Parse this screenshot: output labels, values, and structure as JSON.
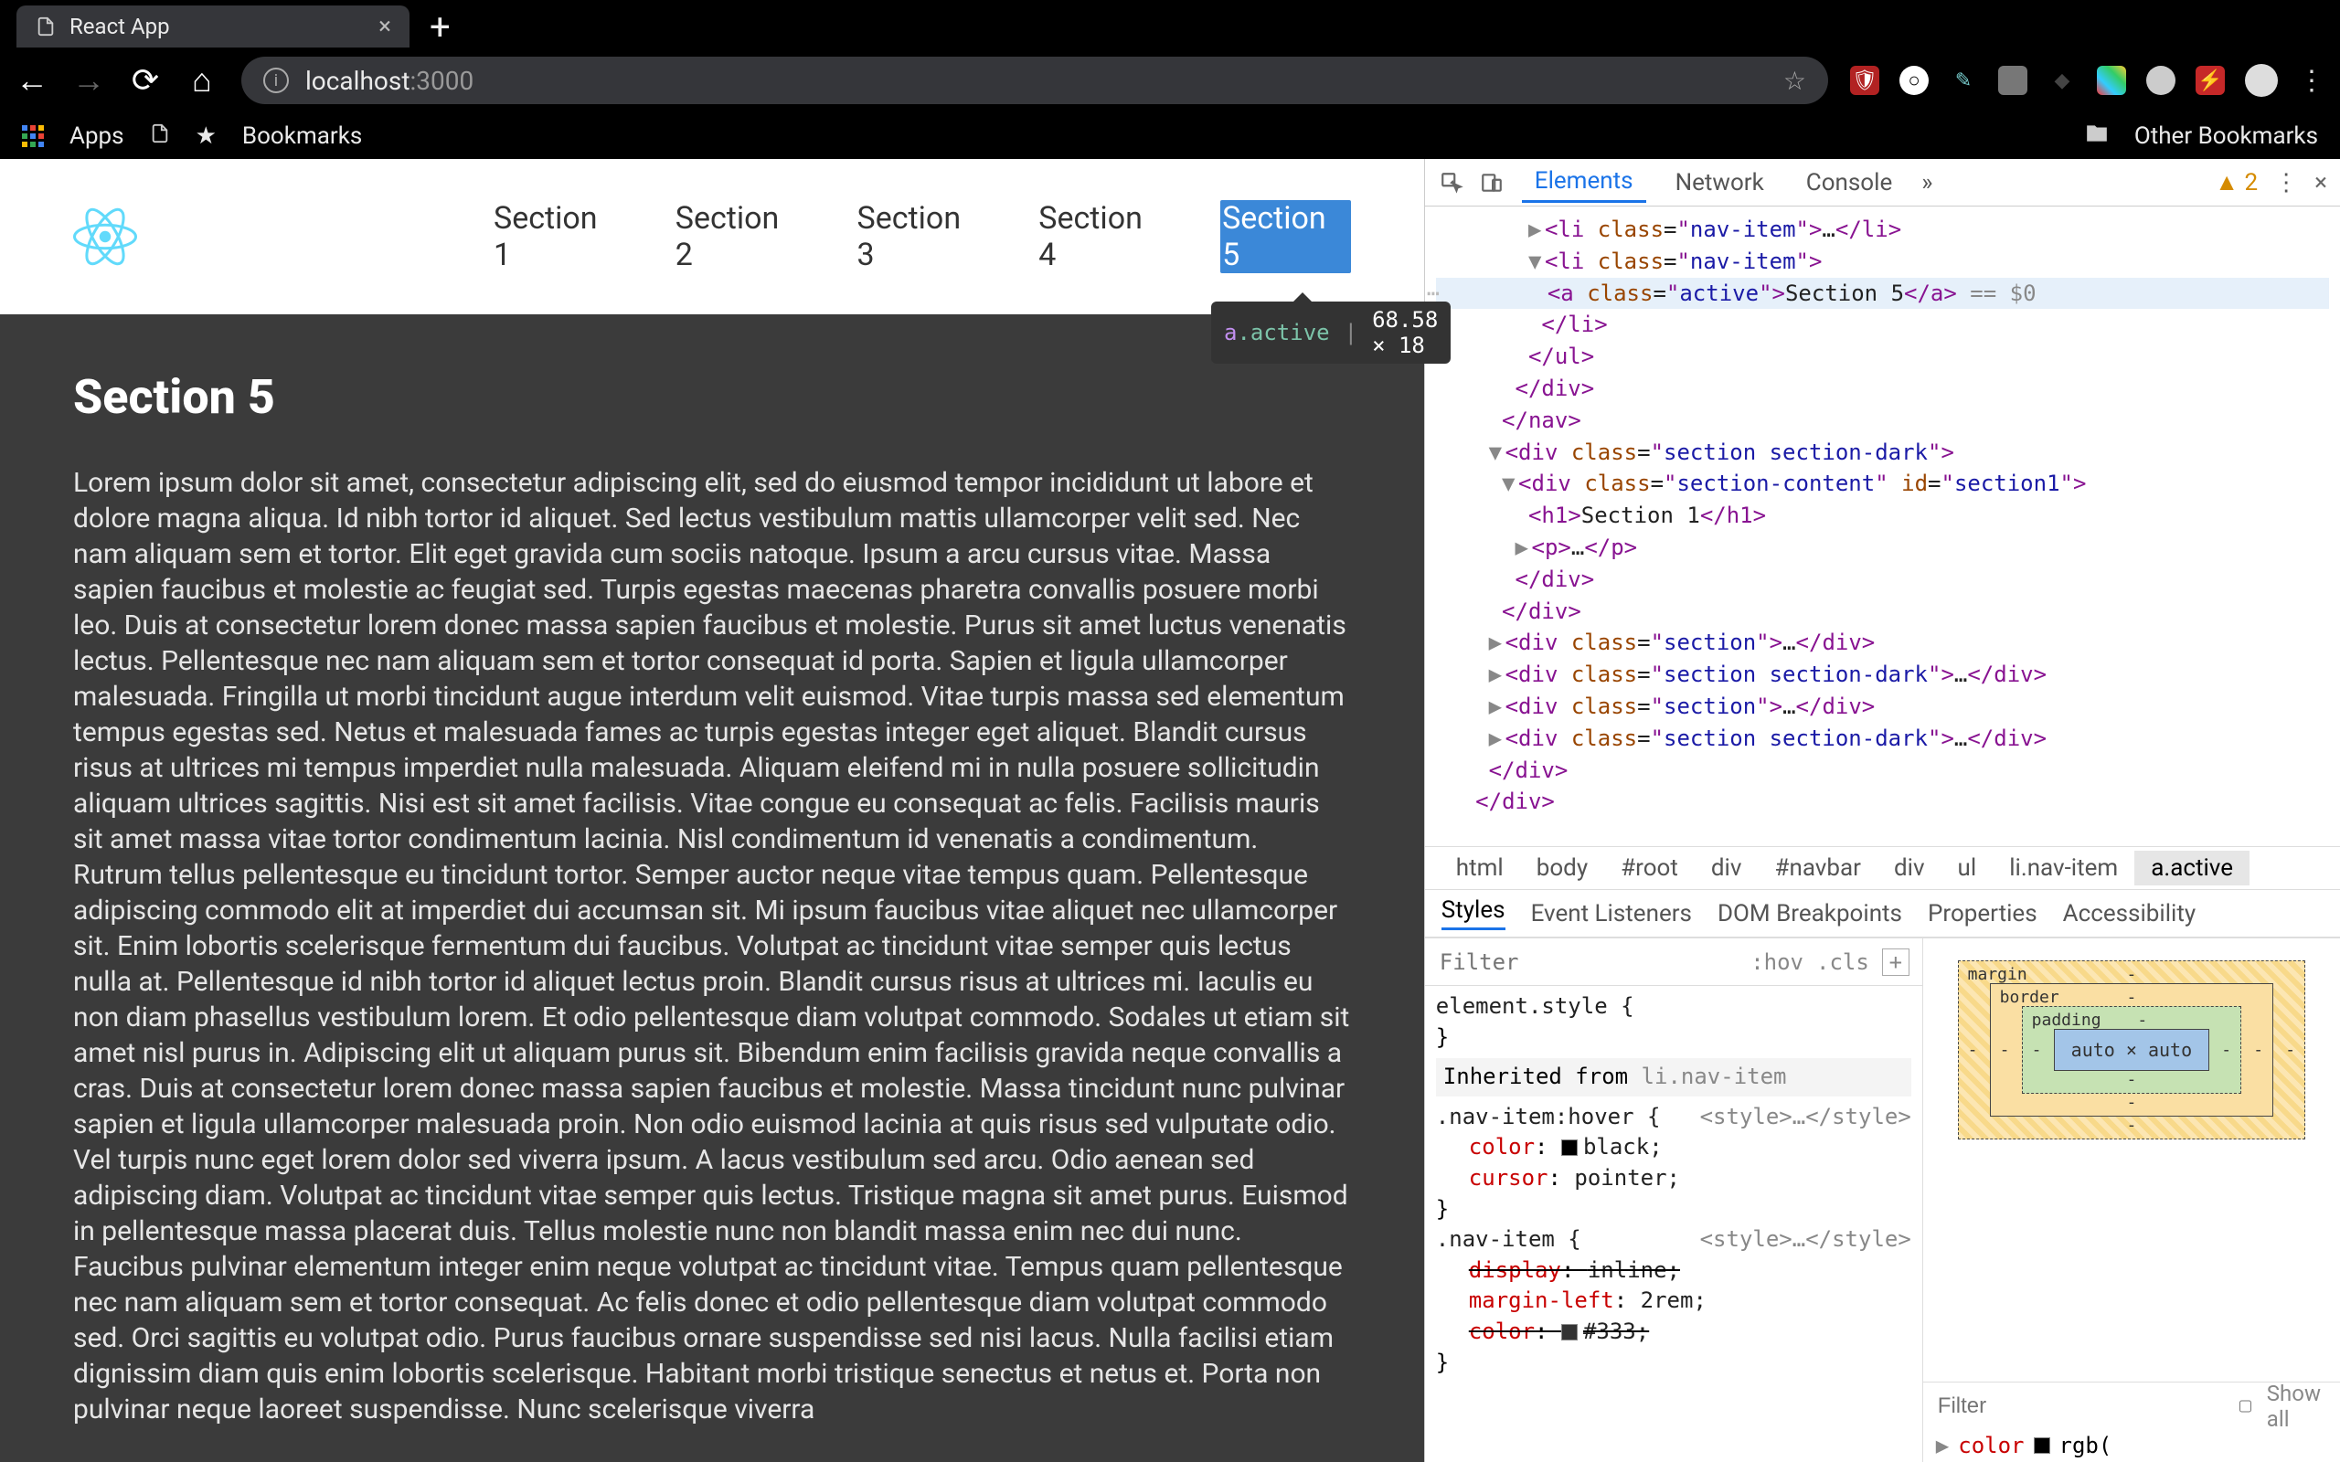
{
  "browser": {
    "tab_title": "React App",
    "new_tab_label": "+",
    "url_host": "localhost",
    "url_port": ":3000",
    "bookmarks": {
      "apps": "Apps",
      "bookmarks": "Bookmarks",
      "other": "Other Bookmarks"
    }
  },
  "page": {
    "nav_items": [
      "Section 1",
      "Section 2",
      "Section 3",
      "Section 4",
      "Section 5"
    ],
    "active_index": 4,
    "tooltip": {
      "selector_tag": "a",
      "selector_class": ".active",
      "dimensions": "68.58 × 18"
    },
    "heading": "Section 5",
    "body": "Lorem ipsum dolor sit amet, consectetur adipiscing elit, sed do eiusmod tempor incididunt ut labore et dolore magna aliqua. Id nibh tortor id aliquet. Sed lectus vestibulum mattis ullamcorper velit sed. Nec nam aliquam sem et tortor. Elit eget gravida cum sociis natoque. Ipsum a arcu cursus vitae. Massa sapien faucibus et molestie ac feugiat sed. Turpis egestas maecenas pharetra convallis posuere morbi leo. Duis at consectetur lorem donec massa sapien faucibus et molestie. Purus sit amet luctus venenatis lectus. Pellentesque nec nam aliquam sem et tortor consequat id porta. Sapien et ligula ullamcorper malesuada. Fringilla ut morbi tincidunt augue interdum velit euismod. Vitae turpis massa sed elementum tempus egestas sed. Netus et malesuada fames ac turpis egestas integer eget aliquet. Blandit cursus risus at ultrices mi tempus imperdiet nulla malesuada. Aliquam eleifend mi in nulla posuere sollicitudin aliquam ultrices sagittis. Nisi est sit amet facilisis. Vitae congue eu consequat ac felis. Facilisis mauris sit amet massa vitae tortor condimentum lacinia. Nisl condimentum id venenatis a condimentum. Rutrum tellus pellentesque eu tincidunt tortor. Semper auctor neque vitae tempus quam. Pellentesque adipiscing commodo elit at imperdiet dui accumsan sit. Mi ipsum faucibus vitae aliquet nec ullamcorper sit. Enim lobortis scelerisque fermentum dui faucibus. Volutpat ac tincidunt vitae semper quis lectus nulla at. Pellentesque id nibh tortor id aliquet lectus proin. Blandit cursus risus at ultrices mi. Iaculis eu non diam phasellus vestibulum lorem. Et odio pellentesque diam volutpat commodo. Sodales ut etiam sit amet nisl purus in. Adipiscing elit ut aliquam purus sit. Bibendum enim facilisis gravida neque convallis a cras. Duis at consectetur lorem donec massa sapien faucibus et molestie. Massa tincidunt nunc pulvinar sapien et ligula ullamcorper malesuada proin. Non odio euismod lacinia at quis risus sed vulputate odio. Vel turpis nunc eget lorem dolor sed viverra ipsum. A lacus vestibulum sed arcu. Odio aenean sed adipiscing diam. Volutpat ac tincidunt vitae semper quis lectus. Tristique magna sit amet purus. Euismod in pellentesque massa placerat duis. Tellus molestie nunc non blandit massa enim nec dui nunc. Faucibus pulvinar elementum integer enim neque volutpat ac tincidunt vitae. Tempus quam pellentesque nec nam aliquam sem et tortor consequat. Ac felis donec et odio pellentesque diam volutpat commodo sed. Orci sagittis eu volutpat odio. Purus faucibus ornare suspendisse sed nisi lacus. Nulla facilisi etiam dignissim diam quis enim lobortis scelerisque. Habitant morbi tristique senectus et netus et. Porta non pulvinar neque laoreet suspendisse. Nunc scelerisque viverra"
  },
  "devtools": {
    "tabs": [
      "Elements",
      "Network",
      "Console"
    ],
    "warning_count": "2",
    "dom": {
      "li_class": "nav-item",
      "a_class": "active",
      "a_text": "Section 5",
      "dollar": "== $0",
      "section_dark": "section section-dark",
      "section": "section",
      "section_content": "section-content",
      "section_id": "section1",
      "h1_text": "Section 1"
    },
    "breadcrumb": [
      "html",
      "body",
      "#root",
      "div",
      "#navbar",
      "div",
      "ul",
      "li.nav-item",
      "a.active"
    ],
    "styles_tabs": [
      "Styles",
      "Event Listeners",
      "DOM Breakpoints",
      "Properties",
      "Accessibility"
    ],
    "filter_placeholder": "Filter",
    "hov": ":hov",
    "cls": ".cls",
    "rules": {
      "element_style": "element.style {",
      "element_style_close": "}",
      "inherited_from": "Inherited from ",
      "inherited_selector": "li.nav-item",
      "hover_selector": ".nav-item:hover {",
      "hover_src": "<style>…</style>",
      "hover_color_prop": "color",
      "hover_color_val": "black;",
      "hover_cursor_prop": "cursor",
      "hover_cursor_val": "pointer;",
      "navitem_selector": ".nav-item {",
      "navitem_src": "<style>…</style>",
      "navitem_display_prop": "display",
      "navitem_display_val": "inline;",
      "navitem_margin_prop": "margin-left",
      "navitem_margin_val": "2rem;",
      "navitem_color_prop": "color",
      "navitem_color_val": "#333;"
    },
    "boxmodel": {
      "margin_label": "margin",
      "border_label": "border",
      "padding_label": "padding",
      "content": "auto × auto",
      "dash": "-"
    },
    "computed": {
      "filter_placeholder": "Filter",
      "show_all": "Show all",
      "color_prop": "color",
      "color_val": "rgb("
    }
  }
}
